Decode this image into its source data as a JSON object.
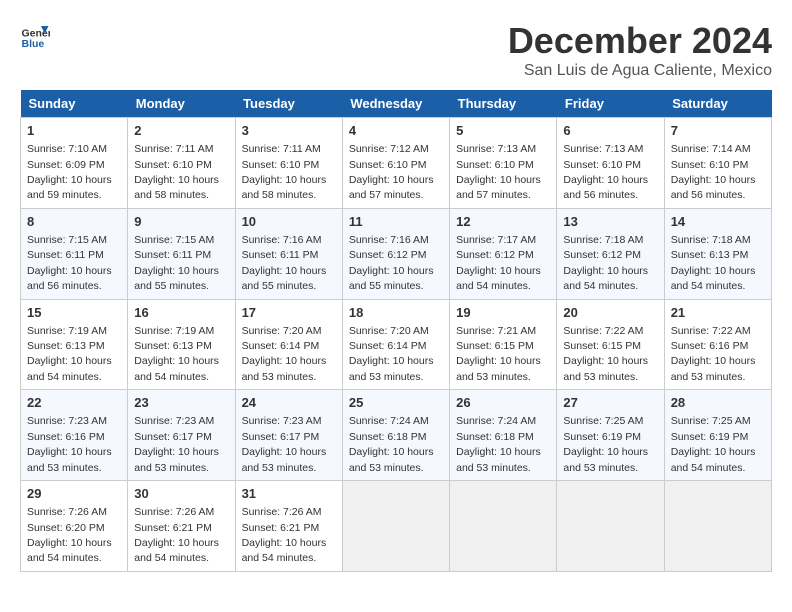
{
  "logo": {
    "line1": "General",
    "line2": "Blue"
  },
  "title": "December 2024",
  "location": "San Luis de Agua Caliente, Mexico",
  "days_of_week": [
    "Sunday",
    "Monday",
    "Tuesday",
    "Wednesday",
    "Thursday",
    "Friday",
    "Saturday"
  ],
  "weeks": [
    [
      {
        "day": "1",
        "sunrise": "7:10 AM",
        "sunset": "6:09 PM",
        "daylight": "10 hours and 59 minutes."
      },
      {
        "day": "2",
        "sunrise": "7:11 AM",
        "sunset": "6:10 PM",
        "daylight": "10 hours and 58 minutes."
      },
      {
        "day": "3",
        "sunrise": "7:11 AM",
        "sunset": "6:10 PM",
        "daylight": "10 hours and 58 minutes."
      },
      {
        "day": "4",
        "sunrise": "7:12 AM",
        "sunset": "6:10 PM",
        "daylight": "10 hours and 57 minutes."
      },
      {
        "day": "5",
        "sunrise": "7:13 AM",
        "sunset": "6:10 PM",
        "daylight": "10 hours and 57 minutes."
      },
      {
        "day": "6",
        "sunrise": "7:13 AM",
        "sunset": "6:10 PM",
        "daylight": "10 hours and 56 minutes."
      },
      {
        "day": "7",
        "sunrise": "7:14 AM",
        "sunset": "6:10 PM",
        "daylight": "10 hours and 56 minutes."
      }
    ],
    [
      {
        "day": "8",
        "sunrise": "7:15 AM",
        "sunset": "6:11 PM",
        "daylight": "10 hours and 56 minutes."
      },
      {
        "day": "9",
        "sunrise": "7:15 AM",
        "sunset": "6:11 PM",
        "daylight": "10 hours and 55 minutes."
      },
      {
        "day": "10",
        "sunrise": "7:16 AM",
        "sunset": "6:11 PM",
        "daylight": "10 hours and 55 minutes."
      },
      {
        "day": "11",
        "sunrise": "7:16 AM",
        "sunset": "6:12 PM",
        "daylight": "10 hours and 55 minutes."
      },
      {
        "day": "12",
        "sunrise": "7:17 AM",
        "sunset": "6:12 PM",
        "daylight": "10 hours and 54 minutes."
      },
      {
        "day": "13",
        "sunrise": "7:18 AM",
        "sunset": "6:12 PM",
        "daylight": "10 hours and 54 minutes."
      },
      {
        "day": "14",
        "sunrise": "7:18 AM",
        "sunset": "6:13 PM",
        "daylight": "10 hours and 54 minutes."
      }
    ],
    [
      {
        "day": "15",
        "sunrise": "7:19 AM",
        "sunset": "6:13 PM",
        "daylight": "10 hours and 54 minutes."
      },
      {
        "day": "16",
        "sunrise": "7:19 AM",
        "sunset": "6:13 PM",
        "daylight": "10 hours and 54 minutes."
      },
      {
        "day": "17",
        "sunrise": "7:20 AM",
        "sunset": "6:14 PM",
        "daylight": "10 hours and 53 minutes."
      },
      {
        "day": "18",
        "sunrise": "7:20 AM",
        "sunset": "6:14 PM",
        "daylight": "10 hours and 53 minutes."
      },
      {
        "day": "19",
        "sunrise": "7:21 AM",
        "sunset": "6:15 PM",
        "daylight": "10 hours and 53 minutes."
      },
      {
        "day": "20",
        "sunrise": "7:22 AM",
        "sunset": "6:15 PM",
        "daylight": "10 hours and 53 minutes."
      },
      {
        "day": "21",
        "sunrise": "7:22 AM",
        "sunset": "6:16 PM",
        "daylight": "10 hours and 53 minutes."
      }
    ],
    [
      {
        "day": "22",
        "sunrise": "7:23 AM",
        "sunset": "6:16 PM",
        "daylight": "10 hours and 53 minutes."
      },
      {
        "day": "23",
        "sunrise": "7:23 AM",
        "sunset": "6:17 PM",
        "daylight": "10 hours and 53 minutes."
      },
      {
        "day": "24",
        "sunrise": "7:23 AM",
        "sunset": "6:17 PM",
        "daylight": "10 hours and 53 minutes."
      },
      {
        "day": "25",
        "sunrise": "7:24 AM",
        "sunset": "6:18 PM",
        "daylight": "10 hours and 53 minutes."
      },
      {
        "day": "26",
        "sunrise": "7:24 AM",
        "sunset": "6:18 PM",
        "daylight": "10 hours and 53 minutes."
      },
      {
        "day": "27",
        "sunrise": "7:25 AM",
        "sunset": "6:19 PM",
        "daylight": "10 hours and 53 minutes."
      },
      {
        "day": "28",
        "sunrise": "7:25 AM",
        "sunset": "6:19 PM",
        "daylight": "10 hours and 54 minutes."
      }
    ],
    [
      {
        "day": "29",
        "sunrise": "7:26 AM",
        "sunset": "6:20 PM",
        "daylight": "10 hours and 54 minutes."
      },
      {
        "day": "30",
        "sunrise": "7:26 AM",
        "sunset": "6:21 PM",
        "daylight": "10 hours and 54 minutes."
      },
      {
        "day": "31",
        "sunrise": "7:26 AM",
        "sunset": "6:21 PM",
        "daylight": "10 hours and 54 minutes."
      },
      null,
      null,
      null,
      null
    ]
  ]
}
